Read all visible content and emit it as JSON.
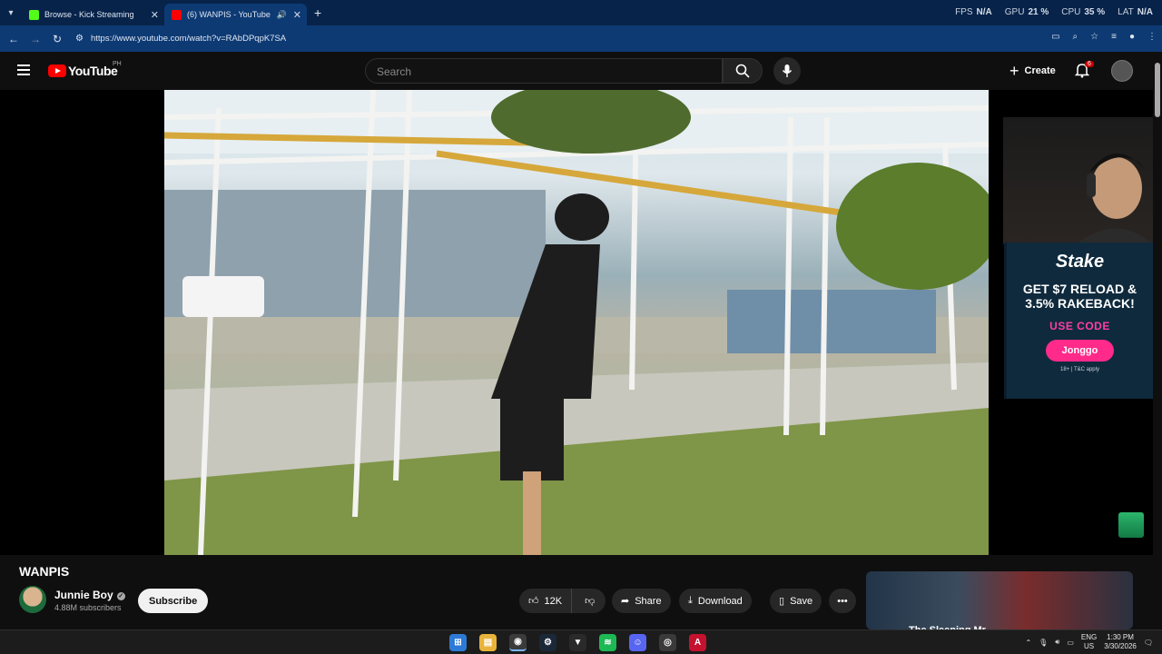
{
  "browser": {
    "tabs": [
      {
        "title": "Browse - Kick Streaming",
        "favicon_color": "#53fc18",
        "active": false
      },
      {
        "title": "(6) WANPIS - YouTube",
        "favicon_color": "#ff0000",
        "active": true
      }
    ],
    "new_tab": "+",
    "url": "https://www.youtube.com/watch?v=RAbDPqpK7SA"
  },
  "perf_overlay": {
    "fps_label": "FPS",
    "fps_value": "N/A",
    "gpu_label": "GPU",
    "gpu_value": "21 %",
    "cpu_label": "CPU",
    "cpu_value": "35 %",
    "lat_label": "LAT",
    "lat_value": "N/A"
  },
  "youtube": {
    "logo_text": "YouTube",
    "country": "PH",
    "search_placeholder": "Search",
    "create_label": "Create",
    "notifications_count": "6"
  },
  "video": {
    "title": "WANPIS",
    "channel": "Junnie Boy",
    "subscribers": "4.88M subscribers",
    "subscribe_label": "Subscribe",
    "likes": "12K",
    "share_label": "Share",
    "download_label": "Download",
    "save_label": "Save"
  },
  "ad": {
    "brand": "Stake",
    "headline_1": "GET $7 RELOAD &",
    "headline_2": "3.5% RAKEBACK!",
    "code_label": "USE CODE",
    "code": "Jonggo",
    "fine_print": "18+ | T&C apply"
  },
  "recommended": {
    "title": "The Sleeping Mr..."
  },
  "taskbar": {
    "lang_1": "ENG",
    "lang_2": "US",
    "time": "1:30 PM",
    "date": "3/30/2026"
  },
  "colors": {
    "youtube_red": "#ff0000",
    "chrome_frame": "#0e3a74",
    "stake_pink": "#ff2a8a"
  }
}
